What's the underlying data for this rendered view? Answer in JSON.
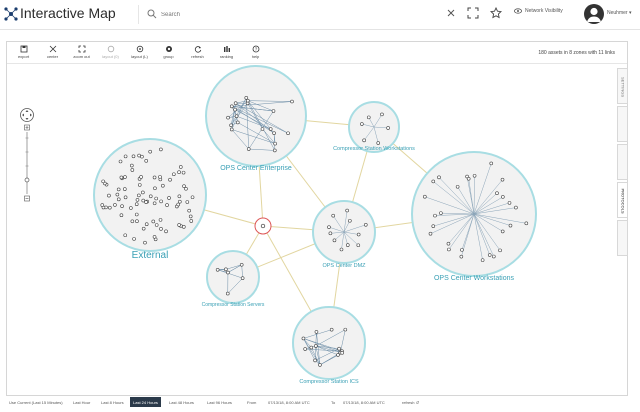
{
  "app": {
    "title": "Interactive Map"
  },
  "search": {
    "placeholder": "Search"
  },
  "header": {
    "network_visibility": "Network Visibility",
    "user": "Neuhmer"
  },
  "toolbar": {
    "tools": [
      {
        "label": "export"
      },
      {
        "label": "center"
      },
      {
        "label": "zoom out"
      },
      {
        "label": "layout (0)"
      },
      {
        "label": "layout (L)"
      },
      {
        "label": "group"
      },
      {
        "label": "refresh"
      },
      {
        "label": "ranking"
      },
      {
        "label": "help"
      }
    ],
    "assets_summary": "180 assets in 8 zones with 11 links"
  },
  "right_tabs": [
    "SETTINGS",
    "",
    "",
    "PROTOCOLS",
    ""
  ],
  "zones": [
    {
      "id": "enterprise",
      "label": "OPS Center Enterprise"
    },
    {
      "id": "external",
      "label": "External"
    },
    {
      "id": "csw",
      "label": "Compressor Station Workstations"
    },
    {
      "id": "ocw",
      "label": "OPS Center Workstations"
    },
    {
      "id": "dmz",
      "label": "OPS Center DMZ"
    },
    {
      "id": "css",
      "label": "Compressor Station Servers"
    },
    {
      "id": "ics",
      "label": "Compressor Station ICS"
    }
  ],
  "time_range": {
    "options": [
      "Use Current (Last 15 Minutes)",
      "Last Hour",
      "Last 8 Hours",
      "Last 24 Hours",
      "Last 48 Hours",
      "Last 96 Hours"
    ],
    "selected": "Last 24 Hours",
    "from_label": "From",
    "from_value": "07/13/18, 8:00 AM UTC",
    "to_label": "To",
    "to_value": "07/13/18, 8:00 AM UTC",
    "refresh_label": "refresh"
  },
  "colors": {
    "zone_label": "#3aa0b5",
    "zone_fill": "#f2f2f2",
    "zone_border": "#a8dde3",
    "link": "#e2d6a0",
    "active_range": "#2b3a4a"
  }
}
